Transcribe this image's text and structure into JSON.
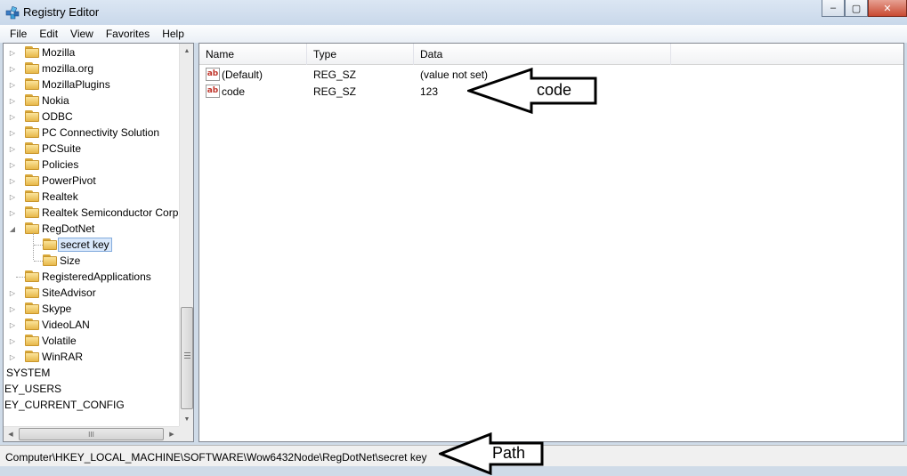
{
  "window": {
    "title": "Registry Editor",
    "controls": {
      "minimize": "‒",
      "maximize": "▢",
      "close": "✕"
    }
  },
  "menu": [
    "File",
    "Edit",
    "View",
    "Favorites",
    "Help"
  ],
  "tree": {
    "items": [
      {
        "label": "Mozilla",
        "expander": "▷"
      },
      {
        "label": "mozilla.org",
        "expander": "▷"
      },
      {
        "label": "MozillaPlugins",
        "expander": "▷"
      },
      {
        "label": "Nokia",
        "expander": "▷"
      },
      {
        "label": "ODBC",
        "expander": "▷"
      },
      {
        "label": "PC Connectivity Solution",
        "expander": "▷"
      },
      {
        "label": "PCSuite",
        "expander": "▷"
      },
      {
        "label": "Policies",
        "expander": "▷"
      },
      {
        "label": "PowerPivot",
        "expander": "▷"
      },
      {
        "label": "Realtek",
        "expander": "▷"
      },
      {
        "label": "Realtek Semiconductor Corp.",
        "expander": "▷"
      },
      {
        "label": "RegDotNet",
        "expander": "◢"
      },
      {
        "label": "secret key",
        "expander": "",
        "selected": true
      },
      {
        "label": "Size",
        "expander": ""
      },
      {
        "label": "RegisteredApplications",
        "expander": ""
      },
      {
        "label": "SiteAdvisor",
        "expander": "▷"
      },
      {
        "label": "Skype",
        "expander": "▷"
      },
      {
        "label": "VideoLAN",
        "expander": "▷"
      },
      {
        "label": "Volatile",
        "expander": "▷"
      },
      {
        "label": "WinRAR",
        "expander": "▷"
      }
    ],
    "roots": [
      "SYSTEM",
      "EY_USERS",
      "EY_CURRENT_CONFIG"
    ],
    "scroll_up": "▲",
    "scroll_down": "▼",
    "scroll_left": "◀",
    "scroll_right": "▶",
    "hthumb_grip": "III"
  },
  "values": {
    "columns": [
      "Name",
      "Type",
      "Data"
    ],
    "rows": [
      {
        "name": "(Default)",
        "type": "REG_SZ",
        "data": "(value not set)",
        "icon": "ab"
      },
      {
        "name": "code",
        "type": "REG_SZ",
        "data": "123",
        "icon": "ab"
      }
    ]
  },
  "statusbar": {
    "path": "Computer\\HKEY_LOCAL_MACHINE\\SOFTWARE\\Wow6432Node\\RegDotNet\\secret key"
  },
  "annotations": {
    "code_label": "code",
    "path_label": "Path"
  }
}
